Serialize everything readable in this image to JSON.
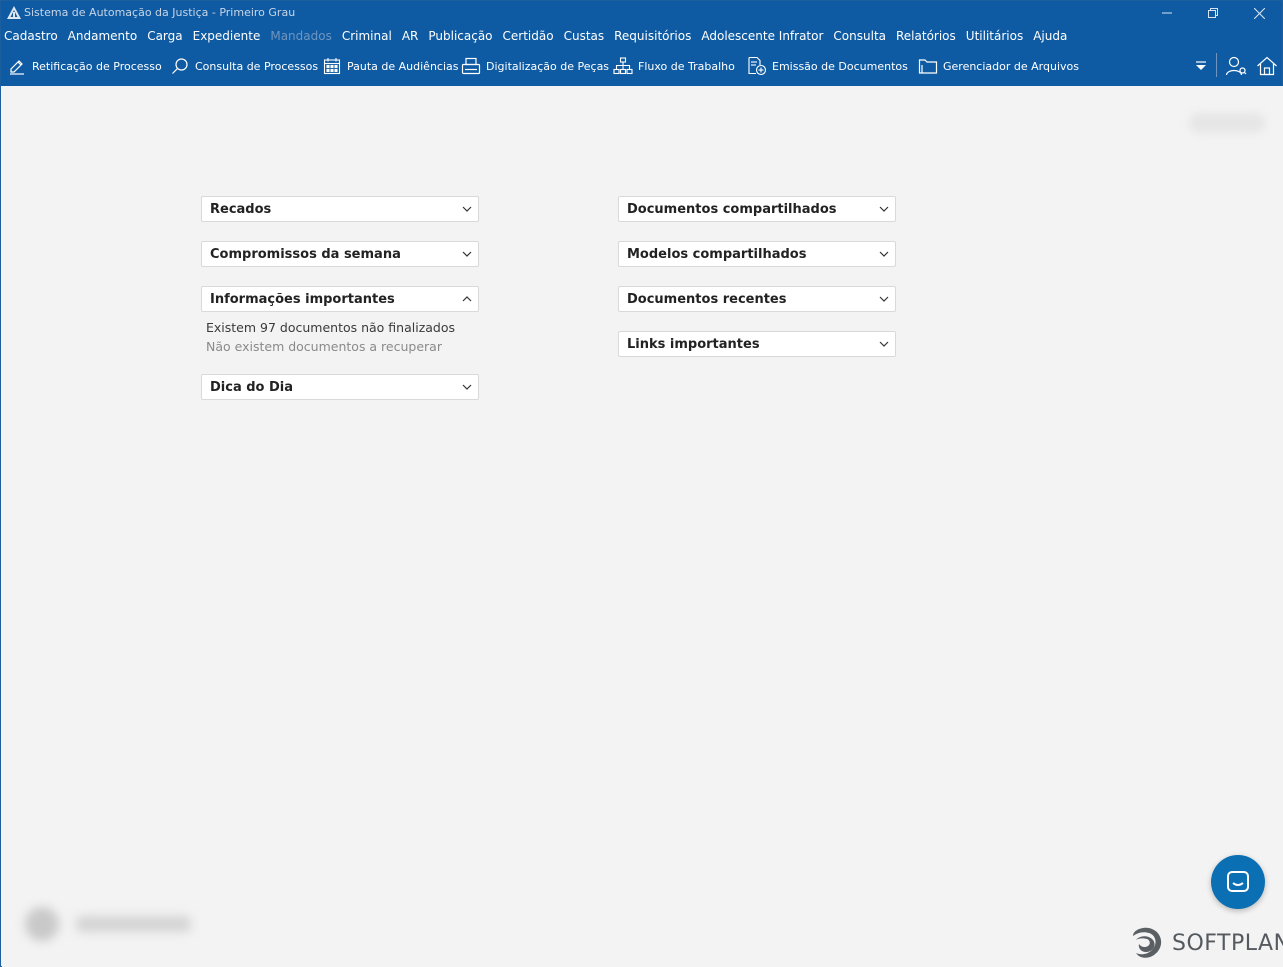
{
  "window": {
    "title": "Sistema de Automação da Justiça - Primeiro Grau"
  },
  "menu": {
    "items": [
      {
        "label": "Cadastro",
        "enabled": true
      },
      {
        "label": "Andamento",
        "enabled": true
      },
      {
        "label": "Carga",
        "enabled": true
      },
      {
        "label": "Expediente",
        "enabled": true
      },
      {
        "label": "Mandados",
        "enabled": false
      },
      {
        "label": "Criminal",
        "enabled": true
      },
      {
        "label": "AR",
        "enabled": true
      },
      {
        "label": "Publicação",
        "enabled": true
      },
      {
        "label": "Certidão",
        "enabled": true
      },
      {
        "label": "Custas",
        "enabled": true
      },
      {
        "label": "Requisitórios",
        "enabled": true
      },
      {
        "label": "Adolescente Infrator",
        "enabled": true
      },
      {
        "label": "Consulta",
        "enabled": true
      },
      {
        "label": "Relatórios",
        "enabled": true
      },
      {
        "label": "Utilitários",
        "enabled": true
      },
      {
        "label": "Ajuda",
        "enabled": true
      }
    ]
  },
  "toolbar": {
    "buttons": [
      {
        "label": "Retificação de Processo",
        "icon": "edit-icon"
      },
      {
        "label": "Consulta de Processos",
        "icon": "search-icon"
      },
      {
        "label": "Pauta de Audiências",
        "icon": "calendar-icon"
      },
      {
        "label": "Digitalização de Peças",
        "icon": "scanner-icon"
      },
      {
        "label": "Fluxo de Trabalho",
        "icon": "workflow-icon"
      },
      {
        "label": "Emissão de Documentos",
        "icon": "document-add-icon"
      },
      {
        "label": "Gerenciador de Arquivos",
        "icon": "folder-icon"
      }
    ]
  },
  "left_panels": {
    "recados": "Recados",
    "compromissos": "Compromissos da semana",
    "informacoes": "Informações importantes",
    "info_line_1": "Existem 97 documentos não finalizados",
    "info_line_2": "Não existem documentos a recuperar",
    "dica": "Dica do Dia"
  },
  "right_panels": {
    "documentos_compartilhados": "Documentos compartilhados",
    "modelos_compartilhados": "Modelos compartilhados",
    "documentos_recentes": "Documentos recentes",
    "links_importantes": "Links importantes"
  },
  "brand": {
    "wordmark": "SOFTPLAN"
  },
  "colors": {
    "titlebar": "#0f5ba3",
    "background": "#f3f3f3",
    "chat_button": "#0b6fb3"
  }
}
